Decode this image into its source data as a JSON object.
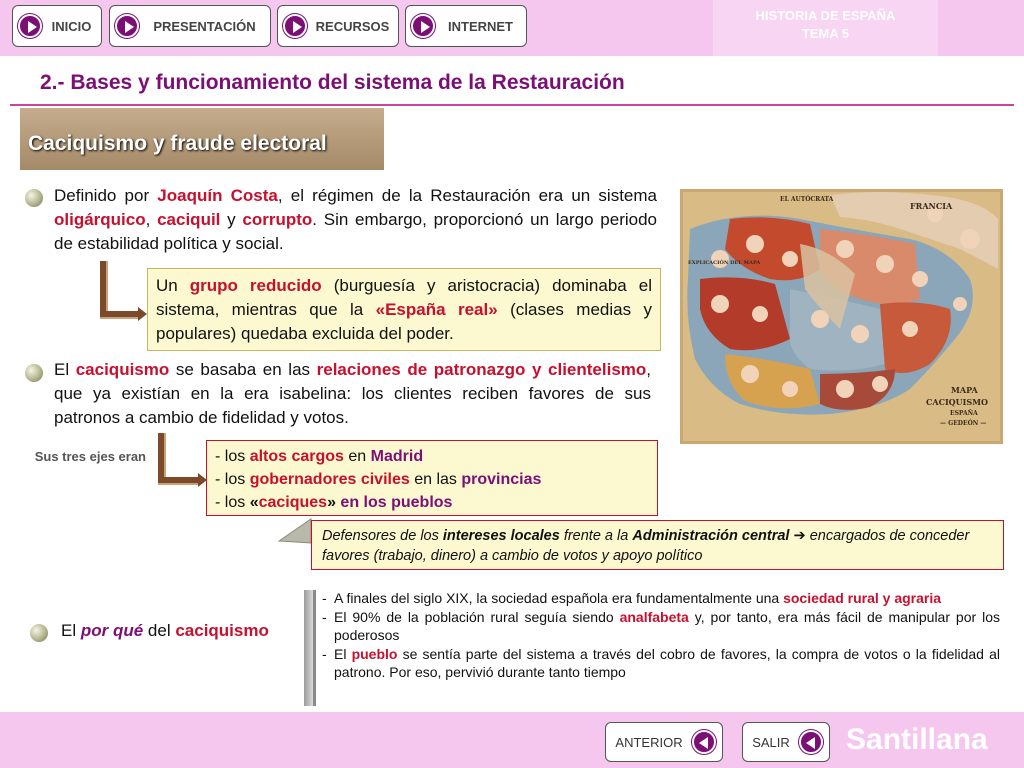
{
  "nav": {
    "inicio": "INICIO",
    "presentacion": "PRESENTACIÓN",
    "recursos": "RECURSOS",
    "internet": "INTERNET"
  },
  "header": {
    "course_line1": "HISTORIA DE ESPAÑA",
    "course_line2": "TEMA 5"
  },
  "title": "2.- Bases y funcionamiento del sistema de la Restauración",
  "section_title": "Caciquismo y fraude electoral",
  "p1": {
    "t1": "Definido por ",
    "costa": "Joaquín Costa",
    "t2": ", el régimen de la Restauración era un sistema ",
    "olig": "oligárquico",
    "t3": ", ",
    "caciquil": "caciquil",
    "t4": " y ",
    "corrupto": "corrupto",
    "t5": ". Sin embargo, proporcionó un largo periodo de estabilidad política y social."
  },
  "box1": {
    "t1": "Un ",
    "grupo": "grupo reducido",
    "t2": " (burguesía y aristocracia) dominaba el sistema, mientras que la ",
    "espana": "«España real»",
    "t3": " (clases medias y populares) quedaba excluida del poder."
  },
  "p2": {
    "t1": "El ",
    "caciquismo": "caciquismo",
    "t2": " se basaba en las ",
    "relaciones": "relaciones de patronazgo y clientelismo",
    "t3": ", que ya existían en la era isabelina: los clientes reciben favores de sus patronos a cambio de fidelidad y votos."
  },
  "ejes": "Sus tres ejes eran",
  "box2": {
    "item1": {
      "pre": "los ",
      "hl": "altos cargos",
      "mid": " en ",
      "place": "Madrid"
    },
    "item2": {
      "pre": "los ",
      "hl": "gobernadores civiles",
      "mid": " en las ",
      "place": "provincias"
    },
    "item3": {
      "pre": "los ",
      "q": "«",
      "hl": "caciques",
      "q2": "»",
      "rest": " en los pueblos"
    }
  },
  "box3": {
    "t1": "Defensores de los ",
    "intereses": "intereses locales",
    "t2": " frente a la ",
    "admin": "Administración central",
    "arrow": " ➔ ",
    "t3": "encargados de conceder favores (trabajo, dinero) a cambio de votos y apoyo político"
  },
  "porque": {
    "t1": "El ",
    "por": "por qué",
    "t2": " del ",
    "caciquismo": "caciquismo"
  },
  "list4": {
    "item1": {
      "t1": "A finales del siglo XIX, la sociedad española era fundamentalmente una ",
      "hl": "sociedad rural y agraria"
    },
    "item2": {
      "t1": "El 90% de la población rural seguía siendo ",
      "hl": "analfabeta",
      "t2": " y, por tanto, era más fácil de manipular por los poderosos"
    },
    "item3": {
      "t1": "El ",
      "hl": "pueblo",
      "t2": " se sentía parte del sistema a través del cobro de favores, la compra de votos o la fidelidad al patrono. Por eso, pervivió durante tanto tiempo"
    }
  },
  "map": {
    "francia": "FRANCIA",
    "mapa": "MAPA",
    "caciquismo": "CACIQUISMO",
    "espana": "ESPAÑA",
    "gedeon": "— GEDEÓN —",
    "explicacion": "EXPLICACIÓN DEL MAPA",
    "inscription": "EL AUTÓCRATA"
  },
  "bottom": {
    "anterior": "ANTERIOR",
    "salir": "SALIR",
    "brand": "Santillana"
  },
  "colors": {
    "accent": "#7b0f76",
    "highlight": "#c8102e",
    "bar": "#f5c7ef"
  }
}
